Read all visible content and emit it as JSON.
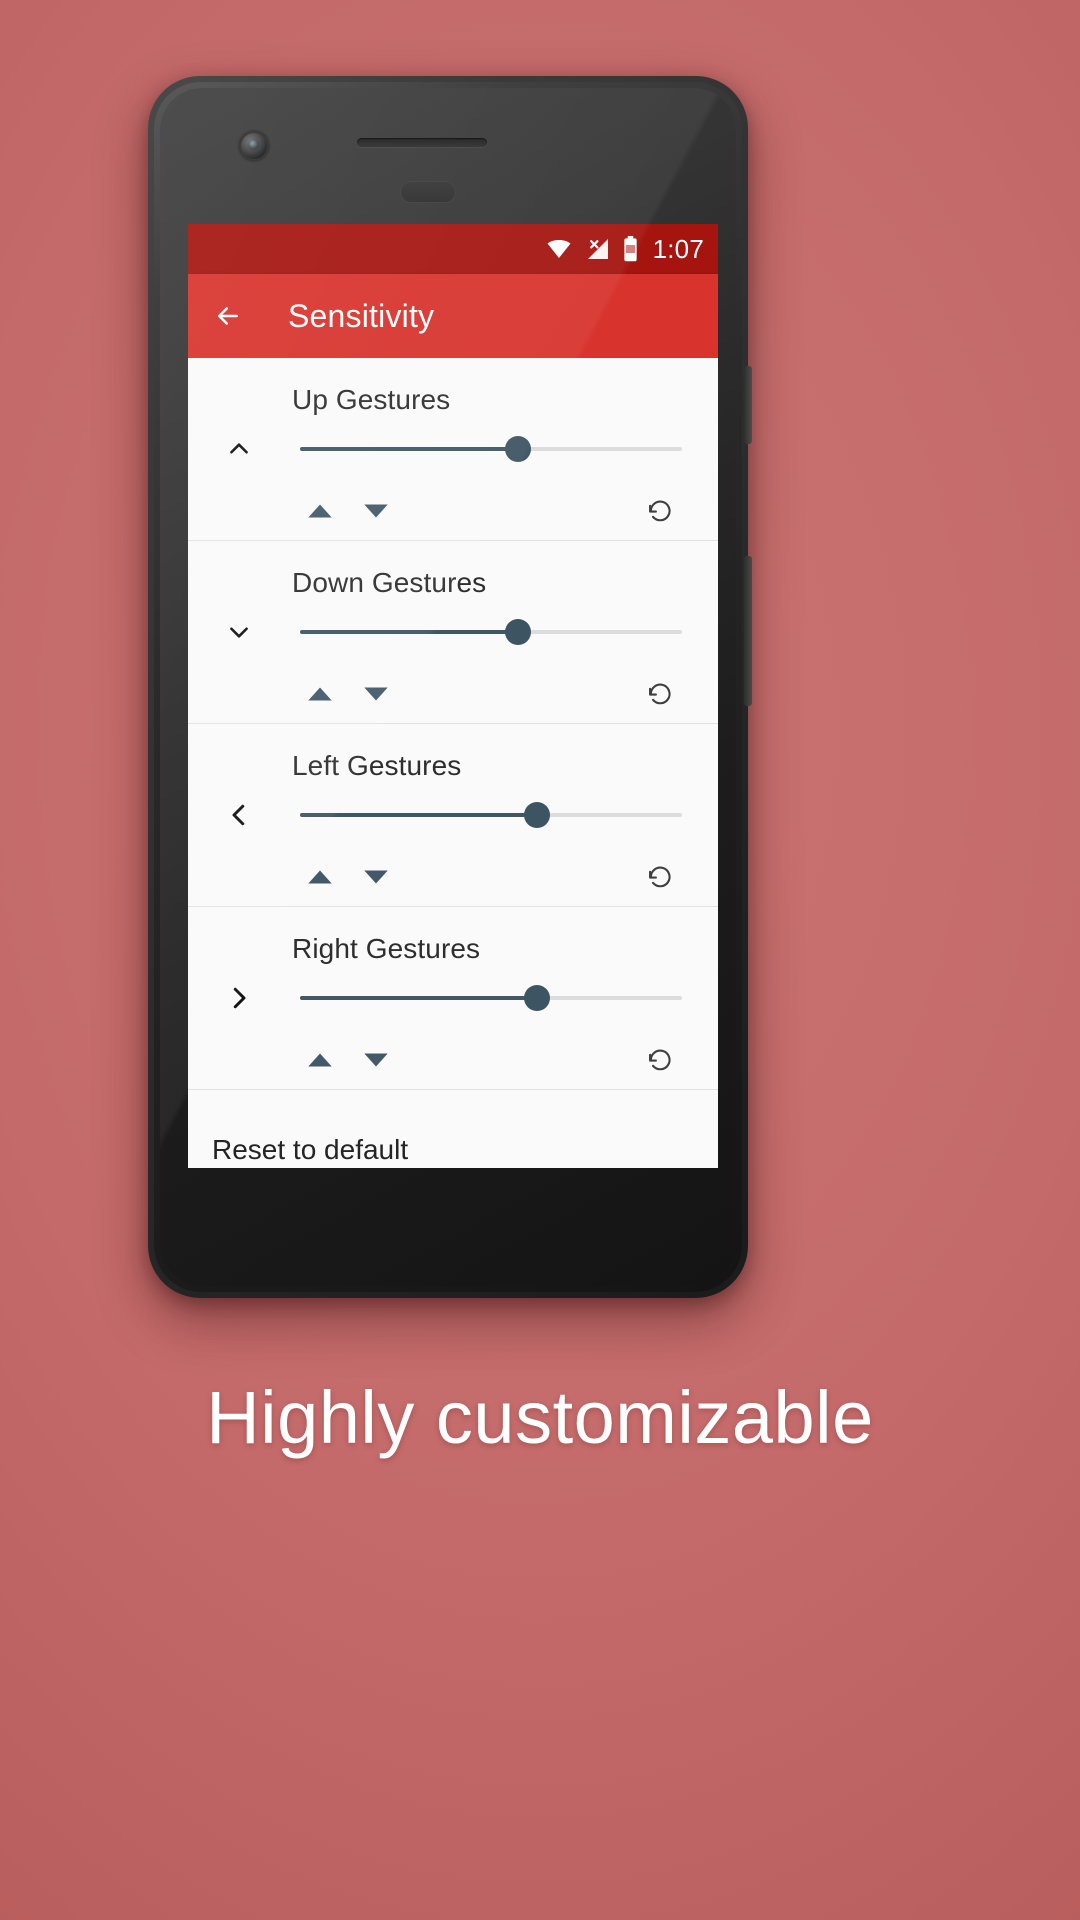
{
  "statusbar": {
    "time": "1:07",
    "icons": [
      "wifi-icon",
      "cellular-no-signal-icon",
      "battery-icon"
    ]
  },
  "appbar": {
    "back_label": "back-arrow-icon",
    "title": "Sensitivity",
    "color": "#d8332d"
  },
  "gestures": [
    {
      "label": "Up Gestures",
      "direction_icon": "chevron-up-icon",
      "value": 57,
      "increase_label": "increase-icon",
      "decrease_label": "decrease-icon",
      "reset_label": "undo-icon"
    },
    {
      "label": "Down Gestures",
      "direction_icon": "chevron-down-icon",
      "value": 57,
      "increase_label": "increase-icon",
      "decrease_label": "decrease-icon",
      "reset_label": "undo-icon"
    },
    {
      "label": "Left Gestures",
      "direction_icon": "chevron-left-icon",
      "value": 62,
      "increase_label": "increase-icon",
      "decrease_label": "decrease-icon",
      "reset_label": "undo-icon"
    },
    {
      "label": "Right Gestures",
      "direction_icon": "chevron-right-icon",
      "value": 62,
      "increase_label": "increase-icon",
      "decrease_label": "decrease-icon",
      "reset_label": "undo-icon"
    }
  ],
  "reset_row": {
    "label": "Reset to default"
  },
  "navbar": {
    "pill_label": "home-gesture-pill"
  },
  "caption": {
    "text": "Highly customizable"
  },
  "colors": {
    "background": "#c46a6a",
    "accent": "#d8332d",
    "statusbar": "#a5140f",
    "slider": "#3d5562",
    "surface": "#fafafa"
  }
}
